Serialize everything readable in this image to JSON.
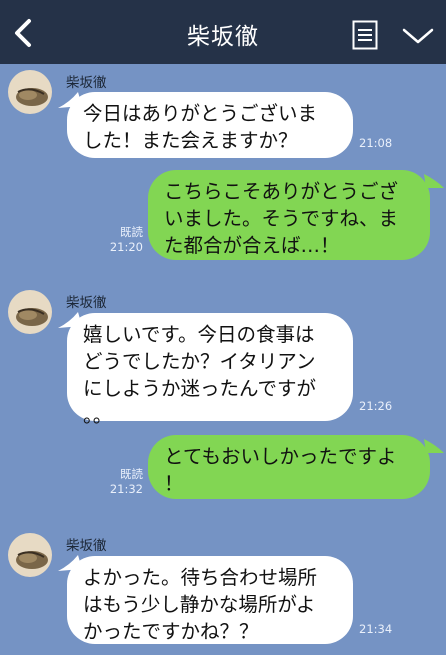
{
  "header": {
    "title": "柴坂徹",
    "back_icon": "chevron-left-icon",
    "menu_icon": "notes-icon",
    "collapse_icon": "chevron-down-icon",
    "bg_color": "#253248"
  },
  "chat": {
    "background_color": "#7593c4",
    "incoming_bubble_color": "#ffffff",
    "outgoing_bubble_color": "#82d653",
    "messages": [
      {
        "direction": "in",
        "sender": "柴坂徹",
        "text": "今日はありがとうございま\nした！また会えますか？",
        "time": "21:08"
      },
      {
        "direction": "out",
        "read_label": "既読",
        "text": "こちらこそありがとうござ\nいました。そうですね、ま\nた都合が合えば…！",
        "time": "21:20"
      },
      {
        "direction": "in",
        "sender": "柴坂徹",
        "text": "嬉しいです。今日の食事は\nどうでしたか？イタリアン\nにしようか迷ったんですが\n。。",
        "time": "21:26"
      },
      {
        "direction": "out",
        "read_label": "既読",
        "text": "とてもおいしかったですよ\n！",
        "time": "21:32"
      },
      {
        "direction": "in",
        "sender": "柴坂徹",
        "text": "よかった。待ち合わせ場所\nはもう少し静かな場所がよ\nかったですかね？？",
        "time": "21:34"
      }
    ]
  }
}
